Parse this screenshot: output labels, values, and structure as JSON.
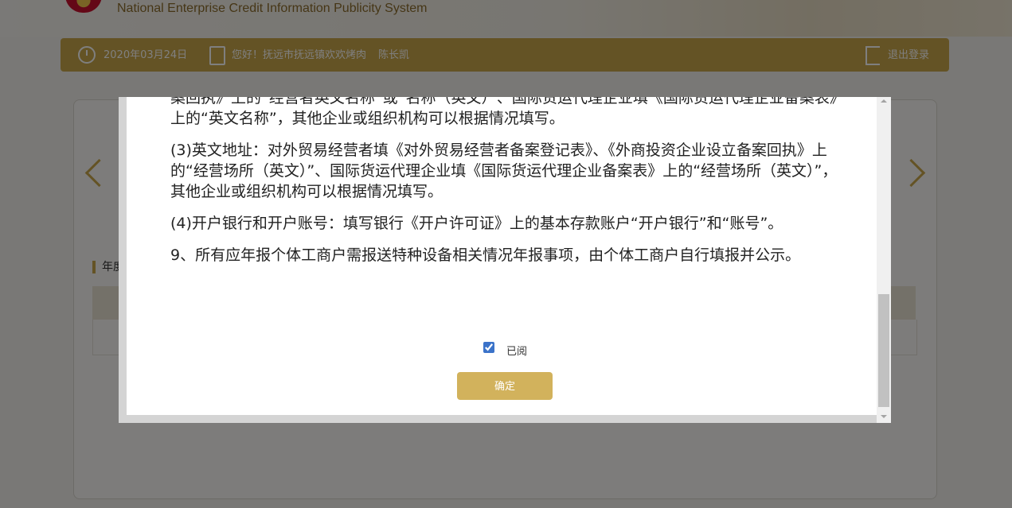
{
  "header": {
    "system_name_en": "National Enterprise Credit Information Publicity System"
  },
  "topbar": {
    "date": "2020年03月24日",
    "greeting": "您好！抚远市抚远镇欢欢烤肉",
    "user_name": "陈长凯",
    "logout_label": "退出登录"
  },
  "background": {
    "section_label": "年度"
  },
  "modal": {
    "paragraphs": [
      "案回执》上的“经营者英文名称”或“名称（英文）”、国际货运代理企业填《国际货运代理企业备案表》上的“英文名称”，其他企业或组织机构可以根据情况填写。",
      "(3)英文地址：对外贸易经营者填《对外贸易经营者备案登记表》、《外商投资企业设立备案回执》上的“经营场所（英文）”、国际货运代理企业填《国际货运代理企业备案表》上的“经营场所（英文）”，其他企业或组织机构可以根据情况填写。",
      "(4)开户银行和开户账号：填写银行《开户许可证》上的基本存款账户“开户银行”和“账号”。",
      "9、所有应年报个体工商户需报送特种设备相关情况年报事项，由个体工商户自行填报并公示。"
    ],
    "read_checkbox_label": "已阅",
    "read_checked": true,
    "confirm_label": "确定"
  }
}
